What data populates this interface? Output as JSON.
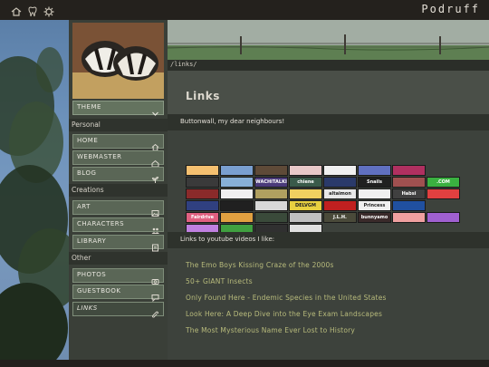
{
  "site": {
    "brand": "Podruff"
  },
  "topbar": {
    "icons": [
      "house-icon",
      "tooth-icon",
      "gear-icon"
    ]
  },
  "sidebar": {
    "theme_label": "THEME",
    "sections": [
      {
        "label": "Personal",
        "items": [
          {
            "label": "HOME",
            "icon": "house-icon"
          },
          {
            "label": "WEBMASTER",
            "icon": "home-icon"
          },
          {
            "label": "BLOG",
            "icon": "plant-icon"
          }
        ]
      },
      {
        "label": "Creations",
        "items": [
          {
            "label": "ART",
            "icon": "image-icon"
          },
          {
            "label": "CHARACTERS",
            "icon": "people-icon"
          },
          {
            "label": "LIBRARY",
            "icon": "book-icon"
          }
        ]
      },
      {
        "label": "Other",
        "items": [
          {
            "label": "PHOTOS",
            "icon": "camera-icon"
          },
          {
            "label": "GUESTBOOK",
            "icon": "speech-icon"
          },
          {
            "label": "LINKS",
            "icon": "paperclip-icon"
          }
        ]
      }
    ]
  },
  "main": {
    "path": "/links/",
    "title": "Links",
    "intro": "Buttonwall, my dear neighbours!",
    "youtube_heading": "Links to youtube videos I like:",
    "youtube_links": [
      "The Emo Boys Kissing Craze of the 2000s",
      "50+ GIANT Insects",
      "Only Found Here - Endemic Species in the United States",
      "Look Here: A Deep Dive into the Eye Exam Landscapes",
      "The Most Mysterious Name Ever Lost to History"
    ]
  },
  "buttons": [
    {
      "text": "",
      "bg": "#f5c070"
    },
    {
      "text": "",
      "bg": "#7a9fd0"
    },
    {
      "text": "",
      "bg": "#5e4a38"
    },
    {
      "text": "",
      "bg": "#e8c8c8"
    },
    {
      "text": "",
      "bg": "#f0f0f0"
    },
    {
      "text": "",
      "bg": "#6070c0"
    },
    {
      "text": "",
      "bg": "#b03060"
    },
    {
      "text": "",
      "bg": "#3a3a3a"
    },
    {
      "text": "",
      "bg": "#88b0d8"
    },
    {
      "text": "WACHITALKI",
      "bg": "#4a3a7a"
    },
    {
      "text": "chiene",
      "bg": "#3a5a4a"
    },
    {
      "text": "",
      "bg": "#2a3a6a"
    },
    {
      "text": "Snails",
      "bg": "#202020"
    },
    {
      "text": "",
      "bg": "#a05050"
    },
    {
      "text": ".COM",
      "bg": "#3ab040"
    },
    {
      "text": "",
      "bg": "#8a2a2a"
    },
    {
      "text": "",
      "bg": "#f0f0f0"
    },
    {
      "text": "",
      "bg": "#b0a060"
    },
    {
      "text": "",
      "bg": "#f0d060"
    },
    {
      "text": "altaimon",
      "bg": "#e8e8e8"
    },
    {
      "text": "",
      "bg": "#f0f0f0"
    },
    {
      "text": "Habsi",
      "bg": "#404040"
    },
    {
      "text": "",
      "bg": "#e04040"
    },
    {
      "text": "",
      "bg": "#304080"
    },
    {
      "text": "",
      "bg": "#202020"
    },
    {
      "text": "",
      "bg": "#d8d8d8"
    },
    {
      "text": "DELVGM",
      "bg": "#e8d040"
    },
    {
      "text": "",
      "bg": "#c02020"
    },
    {
      "text": "Princess",
      "bg": "#f0f0f0"
    },
    {
      "text": "",
      "bg": "#2050a0"
    },
    {
      "text": "Fairdrive",
      "bg": "#e06080"
    },
    {
      "text": "",
      "bg": "#e0a040"
    },
    {
      "text": "",
      "bg": "#3a4a3a"
    },
    {
      "text": "",
      "bg": "#c0c0c0"
    },
    {
      "text": "J.L.H.",
      "bg": "#4a4a3a"
    },
    {
      "text": "bunnyamo",
      "bg": "#3a2a2a"
    },
    {
      "text": "",
      "bg": "#f0a0a0"
    },
    {
      "text": "",
      "bg": "#a060d0"
    },
    {
      "text": "",
      "bg": "#c080e0"
    },
    {
      "text": "",
      "bg": "#40a040"
    },
    {
      "text": "",
      "bg": "#303030"
    },
    {
      "text": "",
      "bg": "#e0e0e0"
    }
  ]
}
